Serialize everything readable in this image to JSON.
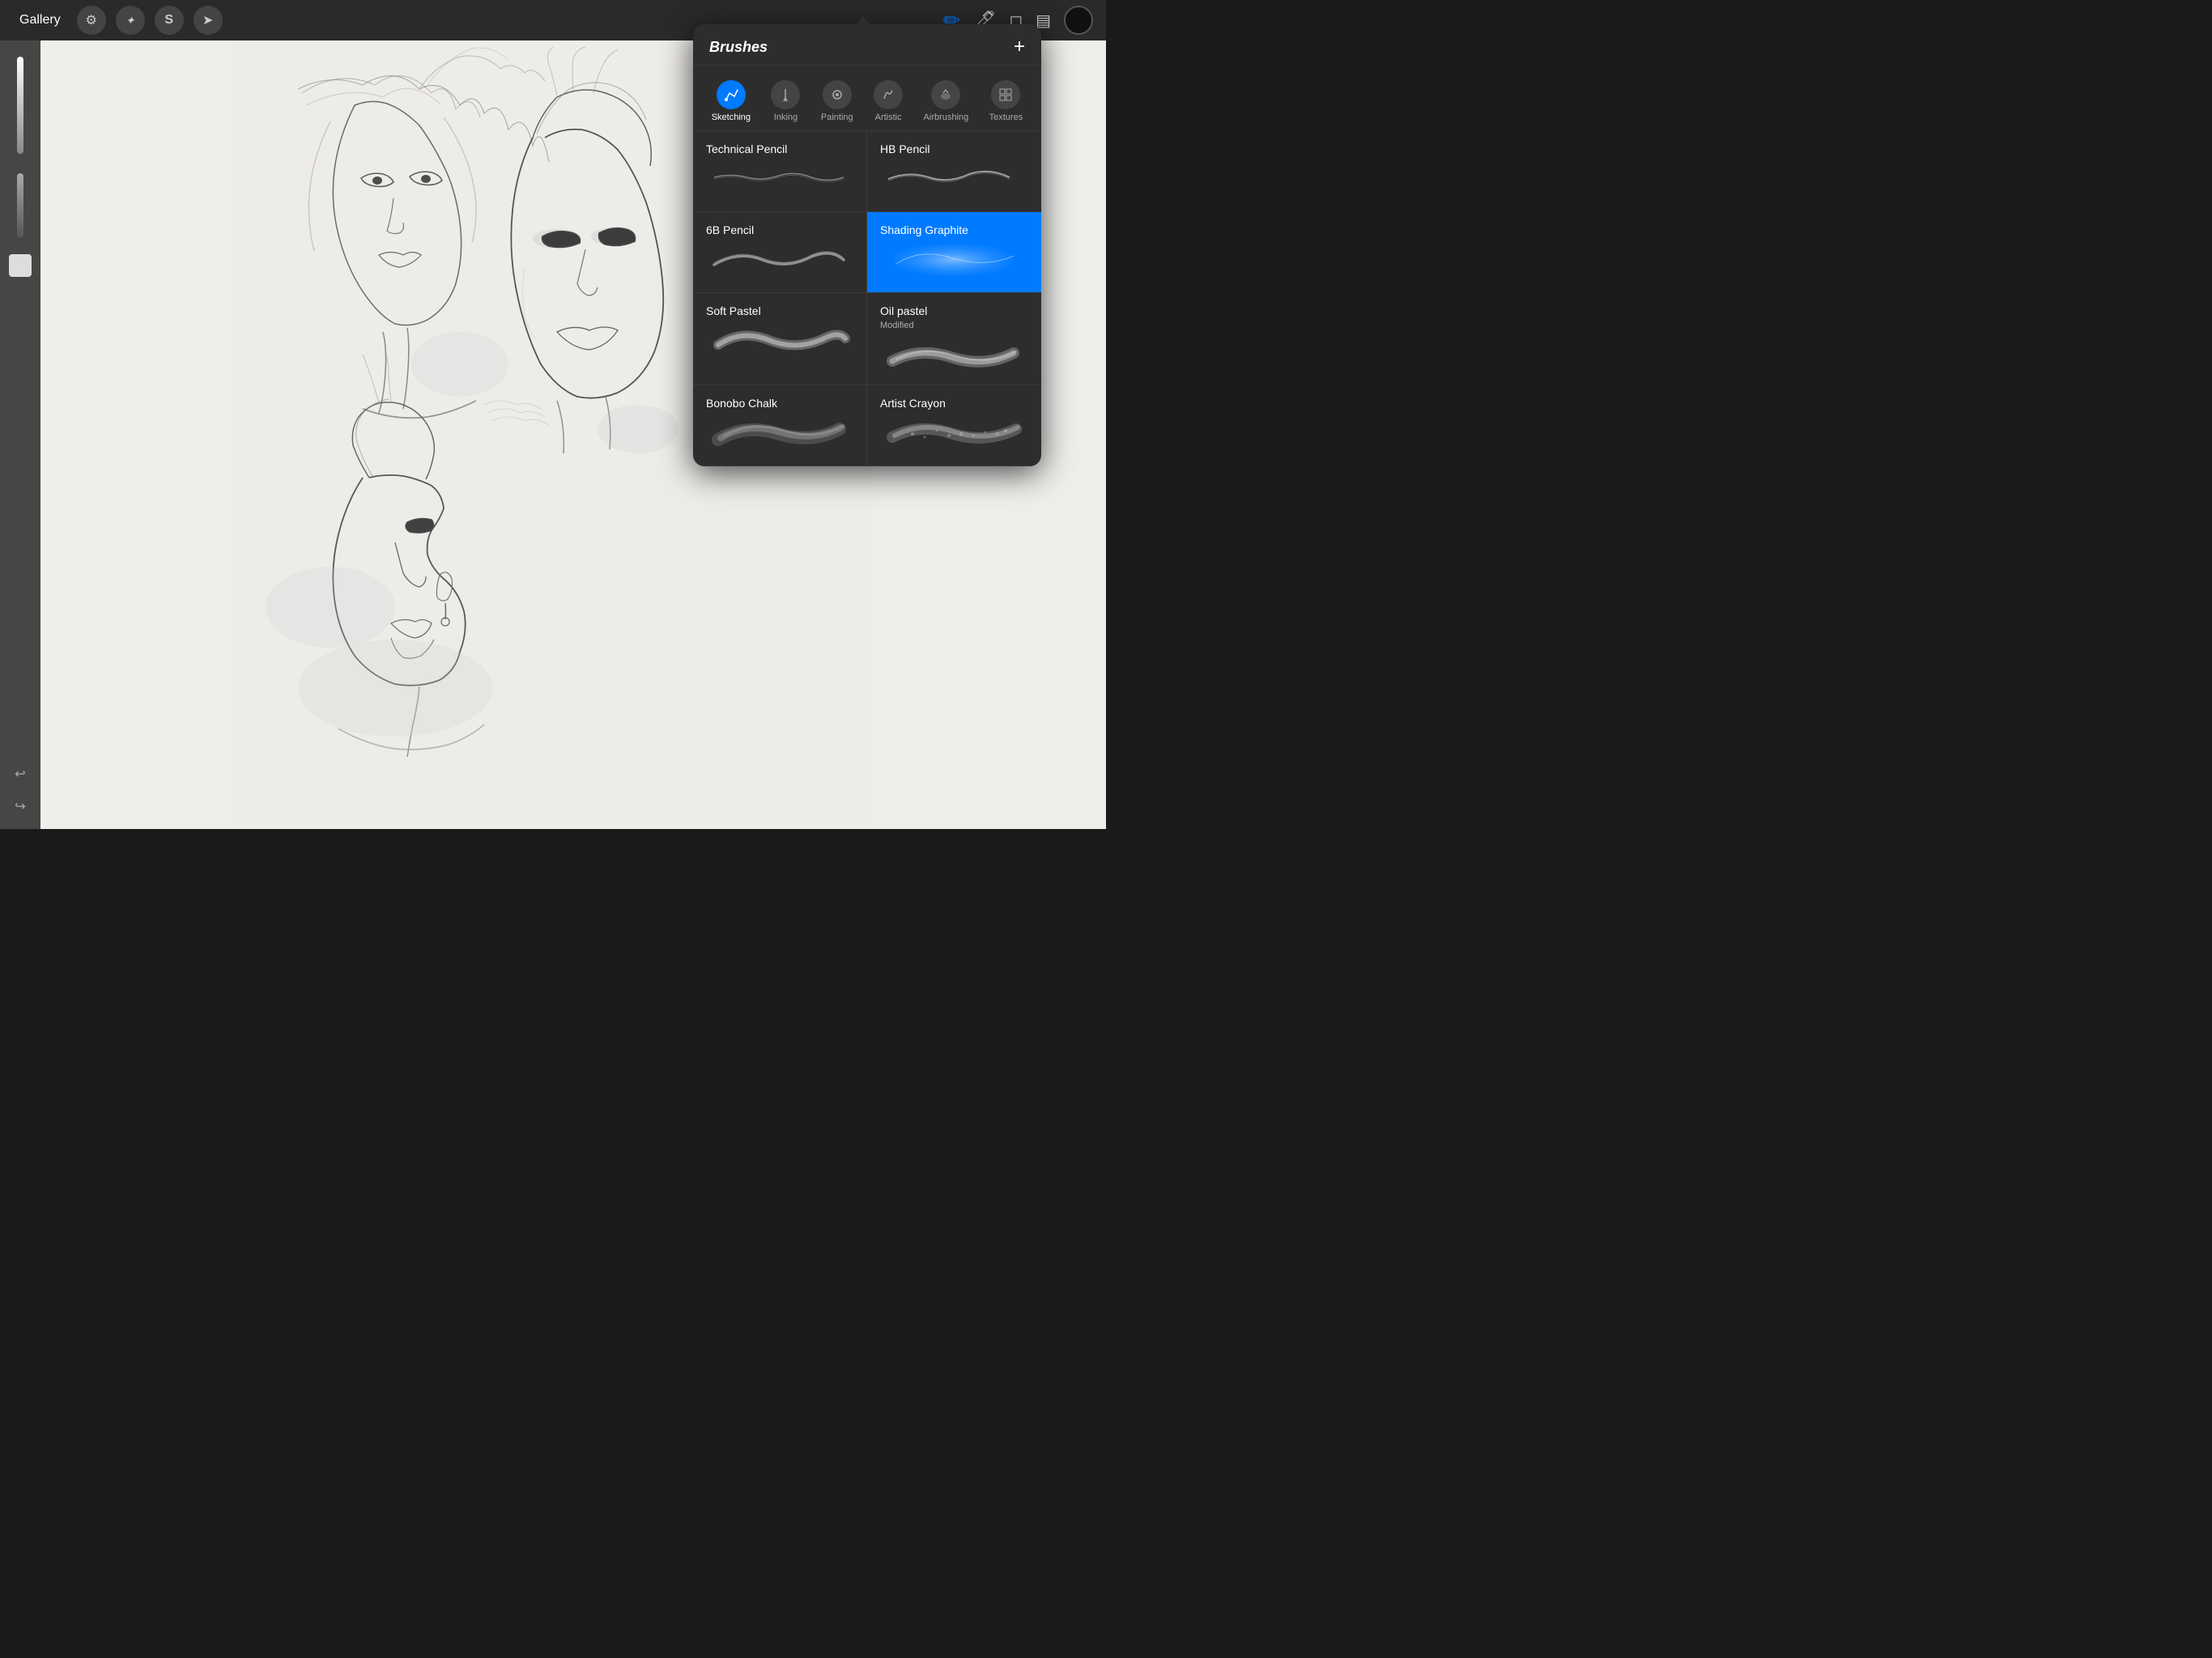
{
  "toolbar": {
    "gallery_label": "Gallery",
    "tools": [
      {
        "name": "wrench",
        "icon": "⚙",
        "active": false
      },
      {
        "name": "magic",
        "icon": "✦",
        "active": false
      },
      {
        "name": "smudge",
        "icon": "S",
        "active": false
      },
      {
        "name": "transform",
        "icon": "✈",
        "active": false
      }
    ],
    "right_tools": [
      {
        "name": "pencil-tool",
        "icon": "✏",
        "active": true,
        "color": "#007aff"
      },
      {
        "name": "inking-tool",
        "icon": "🖊",
        "active": false
      },
      {
        "name": "eraser-tool",
        "icon": "◻",
        "active": false
      },
      {
        "name": "layers-tool",
        "icon": "▤",
        "active": false
      }
    ]
  },
  "panel": {
    "title": "Brushes",
    "add_button": "+",
    "categories": [
      {
        "id": "sketching",
        "label": "Sketching",
        "icon": "✏",
        "active": true
      },
      {
        "id": "inking",
        "label": "Inking",
        "icon": "💧",
        "active": false
      },
      {
        "id": "painting",
        "label": "Painting",
        "icon": "💧",
        "active": false
      },
      {
        "id": "artistic",
        "label": "Artistic",
        "icon": "🎨",
        "active": false
      },
      {
        "id": "airbrushing",
        "label": "Airbrushing",
        "icon": "✦",
        "active": false
      },
      {
        "id": "textures",
        "label": "Textures",
        "icon": "⊞",
        "active": false
      }
    ],
    "brushes": [
      {
        "id": "technical-pencil",
        "name": "Technical Pencil",
        "sub": "",
        "selected": false,
        "stroke_type": "thin-wavy"
      },
      {
        "id": "hb-pencil",
        "name": "HB Pencil",
        "sub": "",
        "selected": false,
        "stroke_type": "medium-wavy"
      },
      {
        "id": "6b-pencil",
        "name": "6B Pencil",
        "sub": "",
        "selected": false,
        "stroke_type": "thick-wavy"
      },
      {
        "id": "shading-graphite",
        "name": "Shading Graphite",
        "sub": "",
        "selected": true,
        "stroke_type": "shading"
      },
      {
        "id": "soft-pastel",
        "name": "Soft Pastel",
        "sub": "",
        "selected": false,
        "stroke_type": "pastel"
      },
      {
        "id": "oil-pastel",
        "name": "Oil pastel",
        "sub": "Modified",
        "selected": false,
        "stroke_type": "oil"
      },
      {
        "id": "bonobo-chalk",
        "name": "Bonobo Chalk",
        "sub": "",
        "selected": false,
        "stroke_type": "chalk"
      },
      {
        "id": "artist-crayon",
        "name": "Artist Crayon",
        "sub": "",
        "selected": false,
        "stroke_type": "crayon"
      }
    ]
  }
}
